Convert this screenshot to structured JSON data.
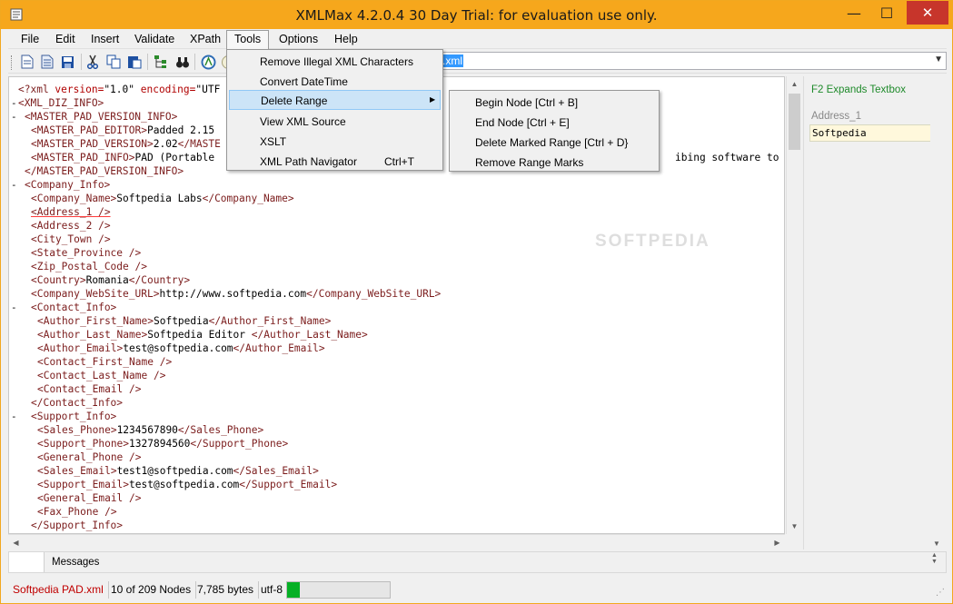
{
  "window": {
    "title": "XMLMax 4.2.0.4 30 Day Trial: for evaluation use only.",
    "accent": "#f6a71c"
  },
  "menu": [
    "File",
    "Edit",
    "Insert",
    "Validate",
    "XPath",
    "Tools",
    "Options",
    "Help"
  ],
  "toolbar": {
    "icons": [
      "new-file-icon",
      "open-file-icon",
      "save-icon",
      "cut-icon",
      "copy-icon",
      "paste-icon",
      "tree-view-icon",
      "binoculars-icon",
      "validate-icon",
      "circle-icon"
    ],
    "path_value": ".xml"
  },
  "tools_menu": [
    {
      "label": "Remove Illegal XML Characters",
      "shortcut": ""
    },
    {
      "label": "Convert DateTime",
      "shortcut": ""
    },
    {
      "label": "Delete Range",
      "shortcut": "",
      "submenu": true
    },
    {
      "label": "View XML Source",
      "shortcut": ""
    },
    {
      "label": "XSLT",
      "shortcut": ""
    },
    {
      "label": "XML Path Navigator",
      "shortcut": "Ctrl+T"
    }
  ],
  "delete_range_menu": [
    "Begin Node [Ctrl + B]",
    "End Node [Ctrl + E]",
    "Delete Marked Range [Ctrl + D}",
    "Remove  Range Marks"
  ],
  "editor": {
    "lines": [
      {
        "fold": "",
        "indent": "",
        "tag": "<?xml ",
        "attr": "version=",
        "text": "\"1.0\" ",
        "attr2": "encoding=",
        "text2": "\"UTF",
        "close": ""
      },
      {
        "fold": "-",
        "indent": "",
        "tag": "<XML_DIZ_INFO>",
        "text": "",
        "close": ""
      },
      {
        "fold": "-",
        "indent": " ",
        "tag": "<MASTER_PAD_VERSION_INFO>",
        "text": "",
        "close": ""
      },
      {
        "fold": "",
        "indent": "  ",
        "tag": "<MASTER_PAD_EDITOR>",
        "text": "Padded 2.15",
        "close": ""
      },
      {
        "fold": "",
        "indent": "  ",
        "tag": "<MASTER_PAD_VERSION>",
        "text": "2.02",
        "close": "</MASTE"
      },
      {
        "fold": "",
        "indent": "  ",
        "tag": "<MASTER_PAD_INFO>",
        "text": "PAD (Portable",
        "close": "",
        "tail": "ibing software to s"
      },
      {
        "fold": "",
        "indent": " ",
        "tag": "</MASTER_PAD_VERSION_INFO>",
        "text": "",
        "close": ""
      },
      {
        "fold": "-",
        "indent": " ",
        "tag": "<Company_Info>",
        "text": "",
        "close": ""
      },
      {
        "fold": "",
        "indent": "  ",
        "tag": "<Company_Name>",
        "text": "Softpedia Labs",
        "close": "</Company_Name>"
      },
      {
        "fold": "",
        "indent": "  ",
        "tag": "<Address_1 />",
        "text": "",
        "close": "",
        "marked": true
      },
      {
        "fold": "",
        "indent": "  ",
        "tag": "<Address_2 />",
        "text": "",
        "close": ""
      },
      {
        "fold": "",
        "indent": "  ",
        "tag": "<City_Town />",
        "text": "",
        "close": ""
      },
      {
        "fold": "",
        "indent": "  ",
        "tag": "<State_Province />",
        "text": "",
        "close": ""
      },
      {
        "fold": "",
        "indent": "  ",
        "tag": "<Zip_Postal_Code />",
        "text": "",
        "close": ""
      },
      {
        "fold": "",
        "indent": "  ",
        "tag": "<Country>",
        "text": "Romania",
        "close": "</Country>"
      },
      {
        "fold": "",
        "indent": "  ",
        "tag": "<Company_WebSite_URL>",
        "text": "http://www.softpedia.com",
        "close": "</Company_WebSite_URL>"
      },
      {
        "fold": "-",
        "indent": "  ",
        "tag": "<Contact_Info>",
        "text": "",
        "close": ""
      },
      {
        "fold": "",
        "indent": "   ",
        "tag": "<Author_First_Name>",
        "text": "Softpedia",
        "close": "</Author_First_Name>"
      },
      {
        "fold": "",
        "indent": "   ",
        "tag": "<Author_Last_Name>",
        "text": "Softpedia Editor ",
        "close": "</Author_Last_Name>"
      },
      {
        "fold": "",
        "indent": "   ",
        "tag": "<Author_Email>",
        "text": "test@softpedia.com",
        "close": "</Author_Email>"
      },
      {
        "fold": "",
        "indent": "   ",
        "tag": "<Contact_First_Name />",
        "text": "",
        "close": ""
      },
      {
        "fold": "",
        "indent": "   ",
        "tag": "<Contact_Last_Name />",
        "text": "",
        "close": ""
      },
      {
        "fold": "",
        "indent": "   ",
        "tag": "<Contact_Email />",
        "text": "",
        "close": ""
      },
      {
        "fold": "",
        "indent": "  ",
        "tag": "</Contact_Info>",
        "text": "",
        "close": ""
      },
      {
        "fold": "-",
        "indent": "  ",
        "tag": "<Support_Info>",
        "text": "",
        "close": ""
      },
      {
        "fold": "",
        "indent": "   ",
        "tag": "<Sales_Phone>",
        "text": "1234567890",
        "close": "</Sales_Phone>"
      },
      {
        "fold": "",
        "indent": "   ",
        "tag": "<Support_Phone>",
        "text": "1327894560",
        "close": "</Support_Phone>"
      },
      {
        "fold": "",
        "indent": "   ",
        "tag": "<General_Phone />",
        "text": "",
        "close": ""
      },
      {
        "fold": "",
        "indent": "   ",
        "tag": "<Sales_Email>",
        "text": "test1@softpedia.com",
        "close": "</Sales_Email>"
      },
      {
        "fold": "",
        "indent": "   ",
        "tag": "<Support_Email>",
        "text": "test@softpedia.com",
        "close": "</Support_Email>"
      },
      {
        "fold": "",
        "indent": "   ",
        "tag": "<General_Email />",
        "text": "",
        "close": ""
      },
      {
        "fold": "",
        "indent": "   ",
        "tag": "<Fax_Phone />",
        "text": "",
        "close": ""
      },
      {
        "fold": "",
        "indent": "  ",
        "tag": "</Support_Info>",
        "text": "",
        "close": ""
      }
    ]
  },
  "side_panel": {
    "hint": "F2 Expands Textbox",
    "field_label": "Address_1",
    "field_value": "Softpedia"
  },
  "messages": {
    "label": "Messages"
  },
  "status": {
    "file": "Softpedia PAD.xml",
    "nodes": "10 of 209 Nodes",
    "bytes": "7,785 bytes",
    "encoding": "utf-8",
    "progress": 0.12
  },
  "watermark": "SOFTPEDIA"
}
